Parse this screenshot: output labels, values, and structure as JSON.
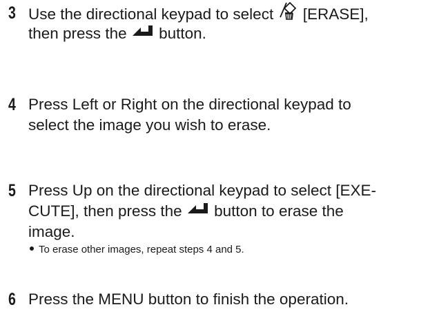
{
  "steps": [
    {
      "number": "3",
      "line1_before_icon": "Use the directional keypad to select ",
      "icon_erase": "erase-trash-icon",
      "line1_after_icon": " [ERASE],",
      "line2_before_icon": "then press the ",
      "icon_ok": "ok-enter-icon",
      "line2_after_icon": " button."
    },
    {
      "number": "4",
      "line1": "Press Left or Right on the directional keypad to",
      "line2": "select the image you wish to erase."
    },
    {
      "number": "5",
      "line1": "Press Up on the directional keypad to select [EXE-",
      "line2_before_icon": "CUTE], then press the ",
      "icon_ok": "ok-enter-icon",
      "line2_after_icon": " button to erase the",
      "line3": "image.",
      "bullet": "To erase other images, repeat steps 4 and 5."
    },
    {
      "number": "6",
      "line1": "Press the MENU button to finish the operation."
    }
  ]
}
